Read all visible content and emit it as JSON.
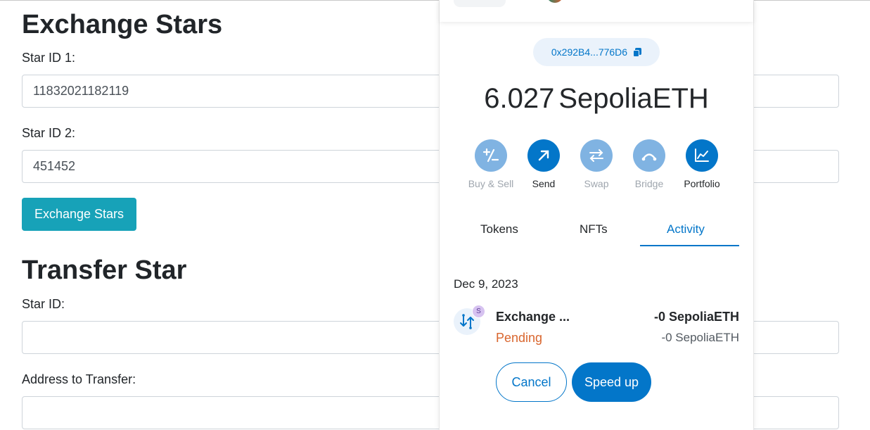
{
  "dapp": {
    "exchange": {
      "heading": "Exchange Stars",
      "star1_label": "Star ID 1:",
      "star1_value": "11832021182119",
      "star2_label": "Star ID 2:",
      "star2_value": "451452",
      "button_label": "Exchange Stars"
    },
    "transfer": {
      "heading": "Transfer Star",
      "star_label": "Star ID:",
      "star_value": "",
      "address_label": "Address to Transfer:",
      "address_value": ""
    },
    "colors": {
      "primary_button": "#17a2b8"
    }
  },
  "wallet": {
    "account_address": "0x292B4...776D6",
    "balance_amount": "6.027",
    "balance_unit": "SepoliaETH",
    "actions": [
      {
        "label": "Buy & Sell",
        "icon": "plus-minus-icon",
        "enabled": false
      },
      {
        "label": "Send",
        "icon": "arrow-up-right-icon",
        "enabled": true
      },
      {
        "label": "Swap",
        "icon": "swap-arrows-icon",
        "enabled": false
      },
      {
        "label": "Bridge",
        "icon": "bridge-icon",
        "enabled": false
      },
      {
        "label": "Portfolio",
        "icon": "chart-icon",
        "enabled": true
      }
    ],
    "tabs": [
      {
        "label": "Tokens",
        "active": false
      },
      {
        "label": "NFTs",
        "active": false
      },
      {
        "label": "Activity",
        "active": true
      }
    ],
    "activity": {
      "date": "Dec 9, 2023",
      "tx": {
        "badge": "S",
        "title": "Exchange ...",
        "status": "Pending",
        "amount": "-0 SepoliaETH",
        "amount_secondary": "-0 SepoliaETH"
      },
      "cancel_label": "Cancel",
      "speed_up_label": "Speed up"
    },
    "colors": {
      "accent": "#0376c9",
      "pending": "#d9662e",
      "disabled_action": "#80b3e2"
    }
  }
}
